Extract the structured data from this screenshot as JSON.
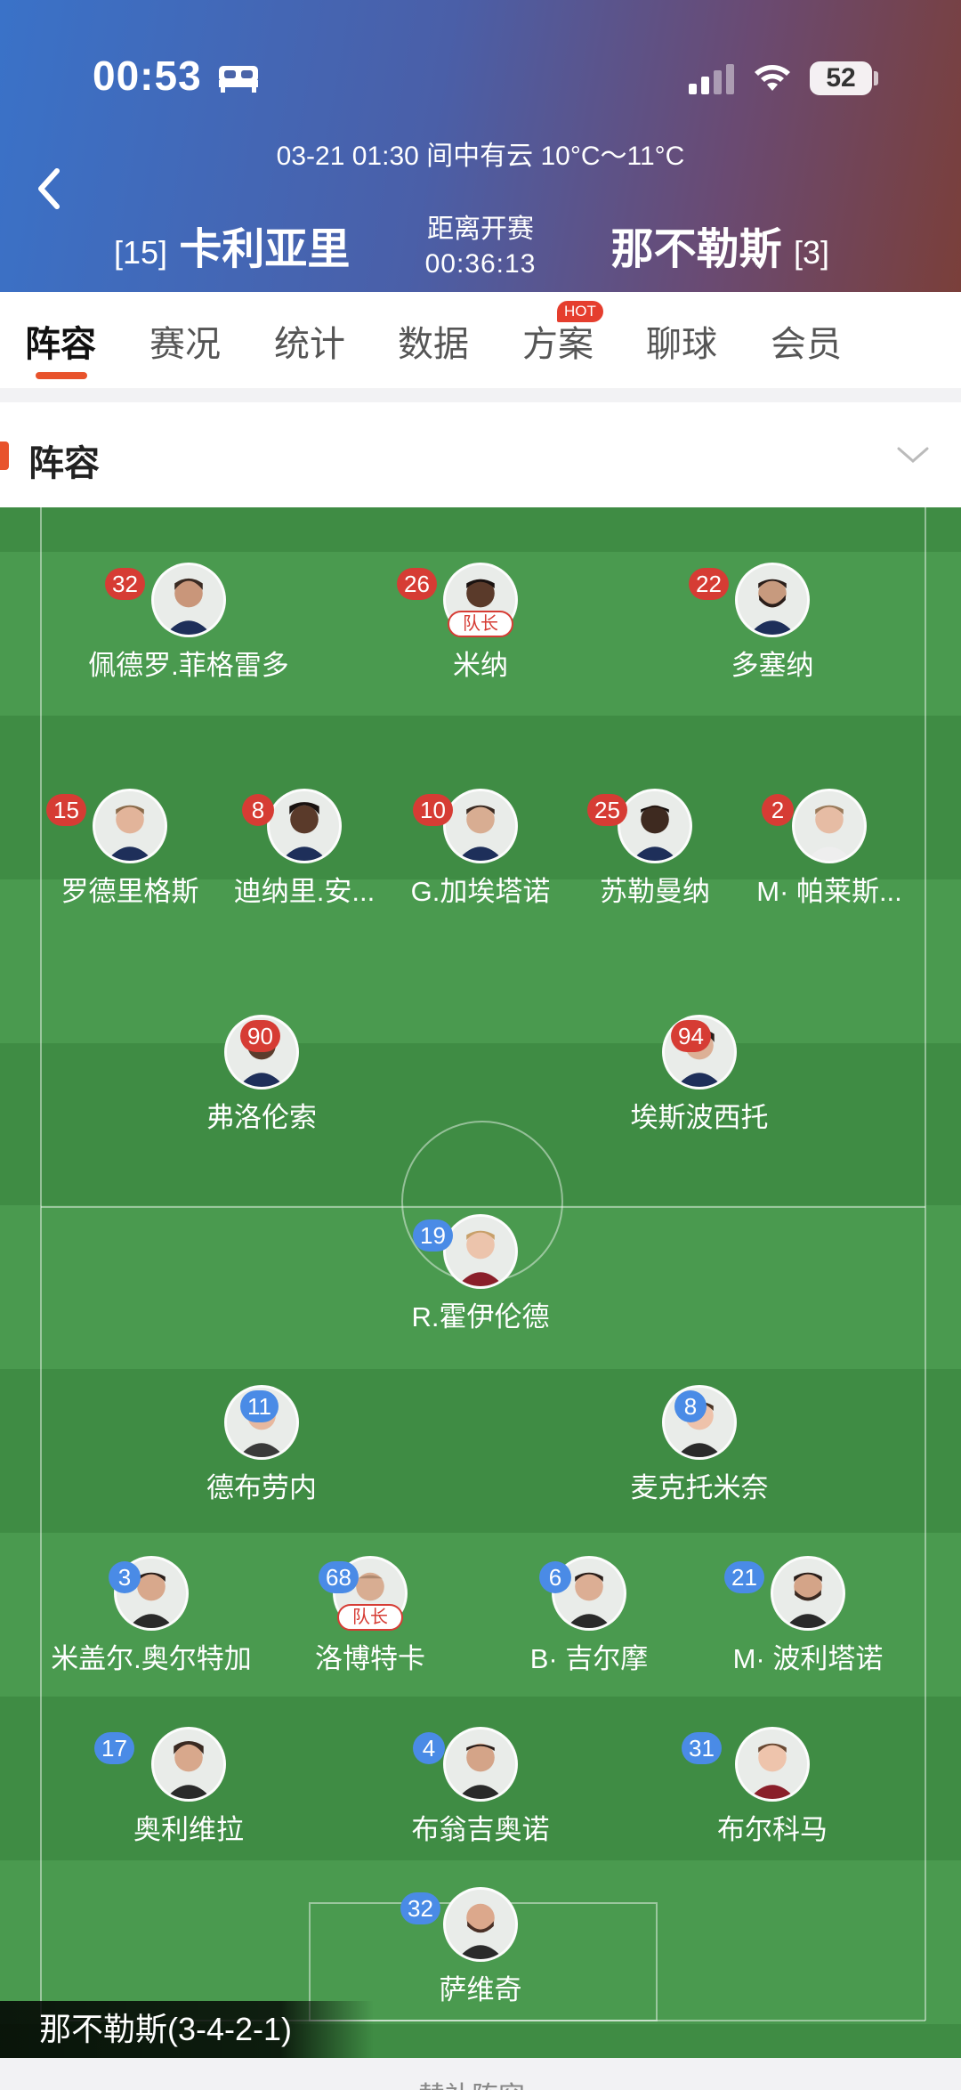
{
  "status_bar": {
    "time": "00:53",
    "battery": "52"
  },
  "match": {
    "info": "03-21 01:30  间中有云 10°C～11°C",
    "home_rank": "[15]",
    "home_name": "卡利亚里",
    "away_name": "那不勒斯",
    "away_rank": "[3]",
    "countdown_label": "距离开赛",
    "countdown_value": "00:36:13"
  },
  "tabs": [
    "阵容",
    "赛况",
    "统计",
    "数据",
    "方案",
    "聊球",
    "会员"
  ],
  "hot_badge": "HOT",
  "section_title": "阵容",
  "captain_label": "队长",
  "home_players": [
    {
      "number": "32",
      "name": "佩德罗.菲格雷多"
    },
    {
      "number": "26",
      "name": "米纳",
      "captain": true
    },
    {
      "number": "22",
      "name": "多塞纳"
    },
    {
      "number": "15",
      "name": "罗德里格斯"
    },
    {
      "number": "8",
      "name": "迪纳里.安..."
    },
    {
      "number": "10",
      "name": "G.加埃塔诺"
    },
    {
      "number": "25",
      "name": "苏勒曼纳"
    },
    {
      "number": "2",
      "name": "M· 帕莱斯..."
    },
    {
      "number": "90",
      "name": "弗洛伦索"
    },
    {
      "number": "94",
      "name": "埃斯波西托"
    }
  ],
  "away_players": [
    {
      "number": "19",
      "name": "R.霍伊伦德"
    },
    {
      "number": "11",
      "name": "德布劳内"
    },
    {
      "number": "8",
      "name": "麦克托米奈"
    },
    {
      "number": "3",
      "name": "米盖尔.奥尔特加"
    },
    {
      "number": "68",
      "name": "洛博特卡",
      "captain": true
    },
    {
      "number": "6",
      "name": "B· 吉尔摩"
    },
    {
      "number": "21",
      "name": "M· 波利塔诺"
    },
    {
      "number": "17",
      "name": "奥利维拉"
    },
    {
      "number": "4",
      "name": "布翁吉奥诺"
    },
    {
      "number": "31",
      "name": "布尔科马"
    },
    {
      "number": "32",
      "name": "萨维奇"
    }
  ],
  "formation_label": "那不勒斯(3-4-2-1)",
  "bottom_text": "替补阵容",
  "colors": {
    "accent": "#e8532c",
    "home_badge": "#d63c34",
    "away_badge": "#4a8be6",
    "pitch": "#3f8c44"
  }
}
